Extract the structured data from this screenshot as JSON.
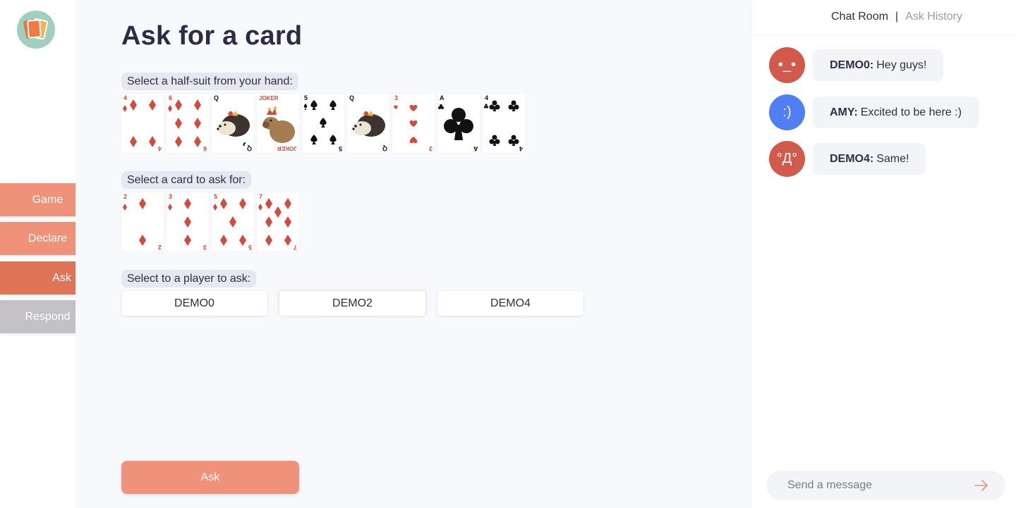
{
  "nav": {
    "game": "Game",
    "declare": "Declare",
    "ask": "Ask",
    "respond": "Respond"
  },
  "main": {
    "title": "Ask for a card",
    "hand_label": "Select a half-suit from your hand:",
    "ask_card_label": "Select a card to ask for:",
    "player_label": "Select to a player to ask:",
    "submit_label": "Ask"
  },
  "hand_cards": [
    {
      "rank": "4",
      "suit": "diamonds"
    },
    {
      "rank": "6",
      "suit": "diamonds"
    },
    {
      "rank": "Q",
      "suit": "clubs"
    },
    {
      "rank": "JOKER",
      "suit": "joker"
    },
    {
      "rank": "5",
      "suit": "spades"
    },
    {
      "rank": "Q",
      "suit": "clubs"
    },
    {
      "rank": "3",
      "suit": "hearts"
    },
    {
      "rank": "A",
      "suit": "clubs"
    },
    {
      "rank": "4",
      "suit": "clubs"
    }
  ],
  "ask_cards": [
    {
      "rank": "2",
      "suit": "diamonds"
    },
    {
      "rank": "3",
      "suit": "diamonds"
    },
    {
      "rank": "5",
      "suit": "diamonds"
    },
    {
      "rank": "7",
      "suit": "diamonds"
    }
  ],
  "players": [
    {
      "name": "DEMO0"
    },
    {
      "name": "DEMO2",
      "selected": true
    },
    {
      "name": "DEMO4"
    }
  ],
  "chat": {
    "tab_chat": "Chat Room",
    "tab_sep": "|",
    "tab_history": "Ask History",
    "messages": [
      {
        "avatar": "•_•",
        "avatar_color": "#d15a4a",
        "user": "DEMO0:",
        "text": "Hey guys!"
      },
      {
        "avatar": ":)",
        "avatar_color": "#4f7ef5",
        "user": "AMY:",
        "text": "Excited to be here :)"
      },
      {
        "avatar": "°Д°",
        "avatar_color": "#d15a4a",
        "user": "DEMO4:",
        "text": "Same!"
      }
    ],
    "input_placeholder": "Send a message"
  },
  "colors": {
    "accent": "#f0927a",
    "accent_active": "#df7556",
    "disabled": "#c3c1c6",
    "card_red": "#d64a3a"
  }
}
